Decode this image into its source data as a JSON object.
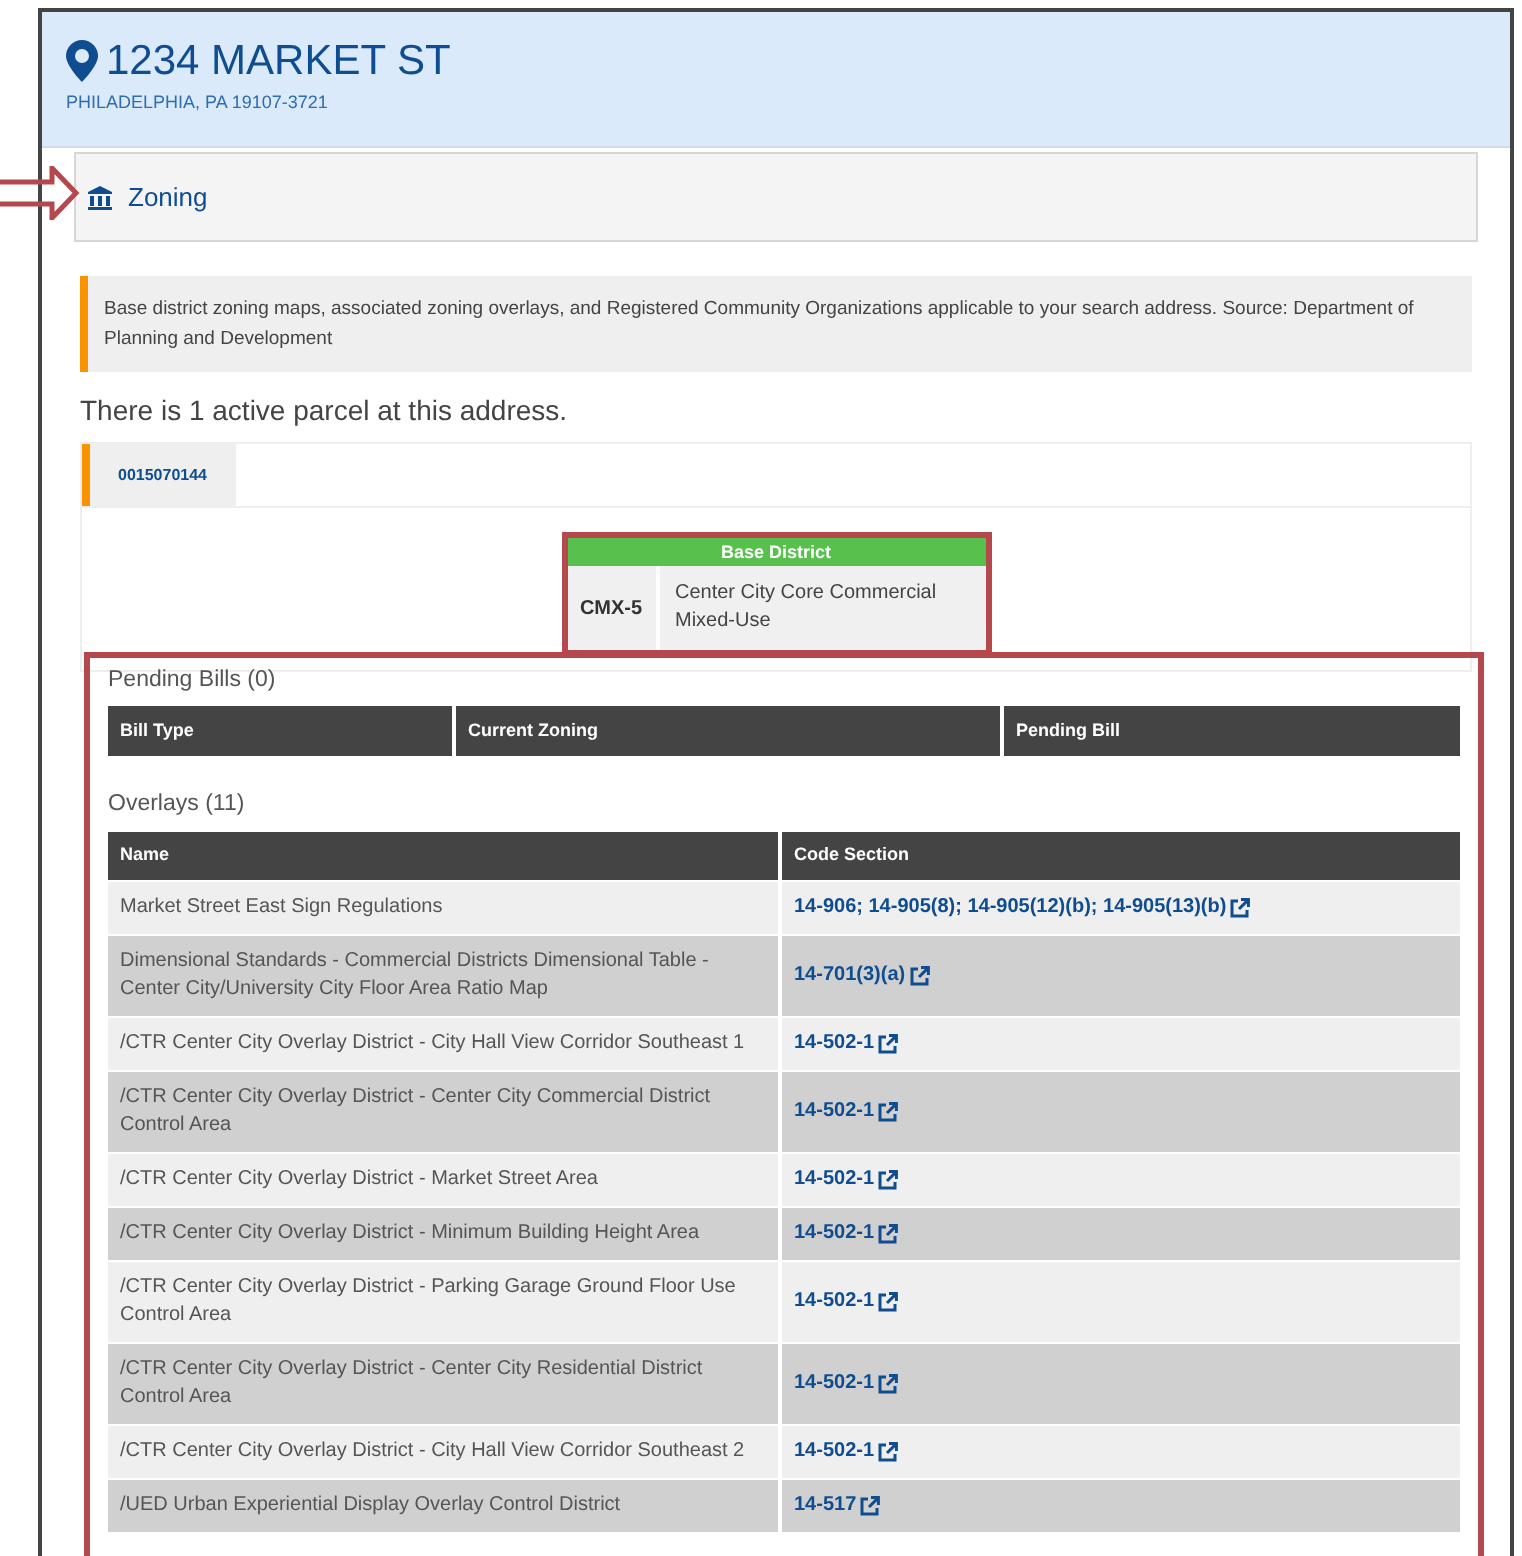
{
  "address": {
    "street": "1234 MARKET ST",
    "city": "PHILADELPHIA, PA 19107-3721"
  },
  "topic": {
    "title": "Zoning"
  },
  "notice": "Base district zoning maps, associated zoning overlays, and Registered Community Organizations applicable to your search address. Source: Department of Planning and Development",
  "parcel_summary": "There is 1 active parcel at this address.",
  "parcel_tabs": [
    {
      "label": "0015070144",
      "selected": true
    }
  ],
  "base_district": {
    "heading": "Base District",
    "code": "CMX-5",
    "description": "Center City Core Commercial Mixed-Use"
  },
  "pending_bills": {
    "title": "Pending Bills (0)",
    "columns": [
      "Bill Type",
      "Current Zoning",
      "Pending Bill"
    ]
  },
  "overlays": {
    "title": "Overlays (11)",
    "columns": [
      "Name",
      "Code Section"
    ],
    "rows": [
      {
        "name": "Market Street East Sign Regulations",
        "code": "14-906; 14-905(8); 14-905(12)(b); 14-905(13)(b)"
      },
      {
        "name": "Dimensional Standards - Commercial Districts Dimensional Table - Center City/University City Floor Area Ratio Map",
        "code": "14-701(3)(a)"
      },
      {
        "name": "/CTR Center City Overlay District - City Hall View Corridor Southeast 1",
        "code": "14-502-1"
      },
      {
        "name": "/CTR Center City Overlay District - Center City Commercial District Control Area",
        "code": "14-502-1"
      },
      {
        "name": "/CTR Center City Overlay District - Market Street Area",
        "code": "14-502-1"
      },
      {
        "name": "/CTR Center City Overlay District - Minimum Building Height Area",
        "code": "14-502-1"
      },
      {
        "name": "/CTR Center City Overlay District - Parking Garage Ground Floor Use Control Area",
        "code": "14-502-1"
      },
      {
        "name": "/CTR Center City Overlay District - Center City Residential District Control Area",
        "code": "14-502-1"
      },
      {
        "name": "/CTR Center City Overlay District - City Hall View Corridor Southeast 2",
        "code": "14-502-1"
      },
      {
        "name": "/UED Urban Experiential Display Overlay Control District",
        "code": "14-517"
      }
    ]
  }
}
